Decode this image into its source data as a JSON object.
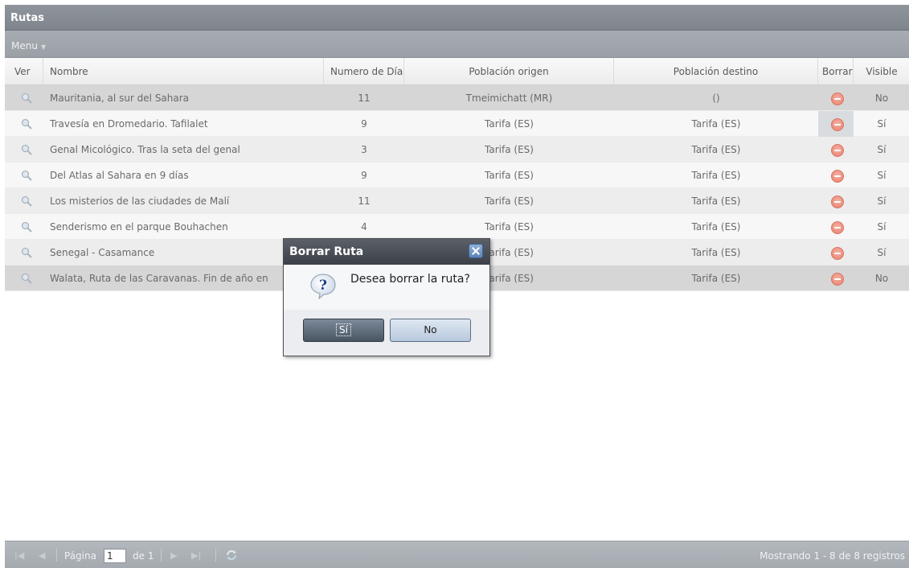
{
  "panel": {
    "title": "Rutas"
  },
  "menu": {
    "label": "Menu"
  },
  "columns": {
    "ver": "Ver",
    "nombre": "Nombre",
    "dias": "Numero de Días",
    "origen": "Población origen",
    "destino": "Población destino",
    "borrar": "Borrar",
    "visible": "Visible"
  },
  "rows": [
    {
      "nombre": "Mauritania, al sur del Sahara",
      "dias": "11",
      "origen": "Tmeimichatt (MR)",
      "destino": "()",
      "visible": "No"
    },
    {
      "nombre": "Travesía en Dromedario. Tafilalet",
      "dias": "9",
      "origen": "Tarifa (ES)",
      "destino": "Tarifa (ES)",
      "visible": "Sí"
    },
    {
      "nombre": "Genal Micológico. Tras la seta del genal",
      "dias": "3",
      "origen": "Tarifa (ES)",
      "destino": "Tarifa (ES)",
      "visible": "Sí"
    },
    {
      "nombre": "Del Atlas al Sahara en 9 días",
      "dias": "9",
      "origen": "Tarifa (ES)",
      "destino": "Tarifa (ES)",
      "visible": "Sí"
    },
    {
      "nombre": "Los misterios de las ciudades de Malí",
      "dias": "11",
      "origen": "Tarifa (ES)",
      "destino": "Tarifa (ES)",
      "visible": "Sí"
    },
    {
      "nombre": "Senderismo en el parque Bouhachen",
      "dias": "4",
      "origen": "Tarifa (ES)",
      "destino": "Tarifa (ES)",
      "visible": "Sí"
    },
    {
      "nombre": "Senegal - Casamance",
      "dias": "",
      "origen": "Tarifa (ES)",
      "destino": "Tarifa (ES)",
      "visible": "Sí"
    },
    {
      "nombre": "Walata, Ruta de las Caravanas. Fin de año en",
      "dias": "",
      "origen": "Tarifa (ES)",
      "destino": "Tarifa (ES)",
      "visible": "No"
    }
  ],
  "paging": {
    "page_label": "Página",
    "page_value": "1",
    "of_label": "de 1",
    "status": "Mostrando 1 - 8 de 8 registros"
  },
  "dialog": {
    "title": "Borrar Ruta",
    "message": "Desea borrar la ruta?",
    "yes_label": "Sí",
    "no_label": "No"
  },
  "icons": {
    "view": "magnifier-icon",
    "delete": "delete-icon",
    "question": "question-icon",
    "close": "close-icon",
    "refresh": "refresh-icon"
  }
}
